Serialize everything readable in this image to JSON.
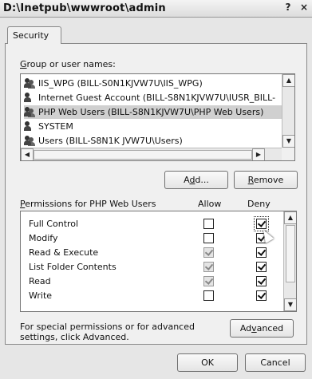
{
  "window": {
    "title": "D:\\Inetpub\\wwwroot\\admin",
    "help_label": "?",
    "close_label": "×"
  },
  "tabs": [
    {
      "label": "Security"
    }
  ],
  "group_label": {
    "prefix": "",
    "underline": "G",
    "rest": "roup or user names:"
  },
  "users": [
    {
      "name": "IIS_WPG (BILL-S0N1KJVW7U\\IIS_WPG)",
      "selected": false
    },
    {
      "name": "Internet Guest Account (BILL-S8N1KJVW7U\\IUSR_BILL-",
      "selected": false
    },
    {
      "name": "PHP Web Users (BILL-S8N1KJVW7U\\PHP Web Users)",
      "selected": true
    },
    {
      "name": "SYSTEM",
      "selected": false
    },
    {
      "name": "Users (BILL-S8N1K JVW7U\\Users)",
      "selected": false
    }
  ],
  "buttons": {
    "add": {
      "prefix": "A",
      "underline": "d",
      "rest": "d..."
    },
    "remove": {
      "prefix": "",
      "underline": "R",
      "rest": "emove"
    },
    "advanced": {
      "prefix": "Ad",
      "underline": "v",
      "rest": "anced"
    },
    "ok": "OK",
    "cancel": "Cancel"
  },
  "permissions": {
    "header": {
      "prefix": "",
      "underline": "P",
      "rest": "ermissions for PHP Web Users"
    },
    "allow_label": "Allow",
    "deny_label": "Deny",
    "rows": [
      {
        "name": "Full Control",
        "allow": false,
        "allow_disabled": false,
        "deny": true
      },
      {
        "name": "Modify",
        "allow": false,
        "allow_disabled": false,
        "deny": true
      },
      {
        "name": "Read & Execute",
        "allow": true,
        "allow_disabled": true,
        "deny": true
      },
      {
        "name": "List Folder Contents",
        "allow": true,
        "allow_disabled": true,
        "deny": true
      },
      {
        "name": "Read",
        "allow": true,
        "allow_disabled": true,
        "deny": true
      },
      {
        "name": "Write",
        "allow": false,
        "allow_disabled": false,
        "deny": true
      }
    ]
  },
  "note": "For special permissions or for advanced settings, click Advanced."
}
